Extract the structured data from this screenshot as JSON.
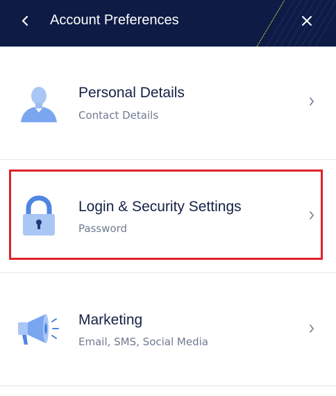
{
  "header": {
    "title": "Account Preferences",
    "back_icon": "chevron-left-icon",
    "close_icon": "close-icon",
    "background": "#0d1b45"
  },
  "menu": {
    "items": [
      {
        "title": "Personal Details",
        "subtitle": "Contact Details",
        "icon": "user-icon"
      },
      {
        "title": "Login & Security Settings",
        "subtitle": "Password",
        "icon": "lock-icon",
        "highlighted": true
      },
      {
        "title": "Marketing",
        "subtitle": "Email, SMS, Social Media",
        "icon": "megaphone-icon"
      }
    ]
  },
  "colors": {
    "accent_icon": "#7aa6f0",
    "title_text": "#142044",
    "subtitle_text": "#6e7a8f",
    "highlight": "#e0202b"
  }
}
